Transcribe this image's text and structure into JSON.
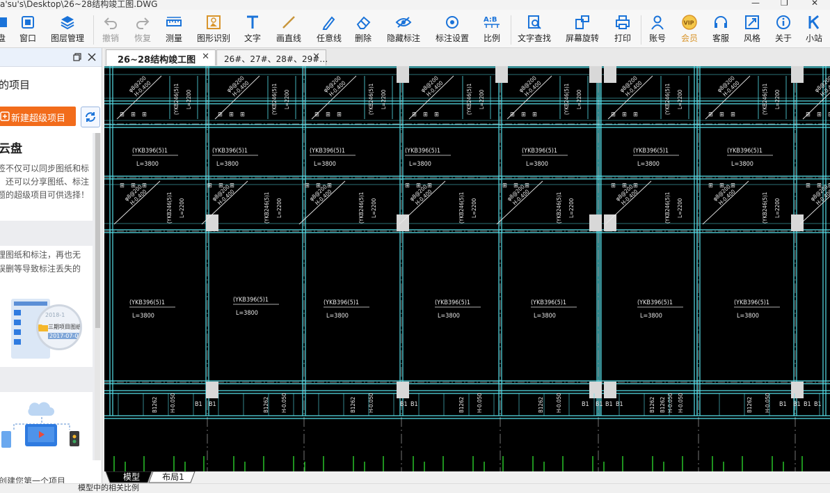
{
  "window": {
    "title": "a'su's\\Desktop\\26~28结构竣工图.DWG"
  },
  "toolbar": {
    "items": [
      {
        "label": "盘",
        "icon": "disk-icon"
      },
      {
        "label": "窗口",
        "icon": "window-icon"
      },
      {
        "label": "图层管理",
        "icon": "layers-icon"
      },
      {
        "label": "撤销",
        "icon": "undo-icon",
        "disabled": true
      },
      {
        "label": "恢复",
        "icon": "redo-icon",
        "disabled": true
      },
      {
        "label": "测量",
        "icon": "ruler-icon"
      },
      {
        "label": "图形识别",
        "icon": "shape-recognize-icon"
      },
      {
        "label": "文字",
        "icon": "text-icon"
      },
      {
        "label": "画直线",
        "icon": "line-icon"
      },
      {
        "label": "任意线",
        "icon": "pencil-icon"
      },
      {
        "label": "删除",
        "icon": "eraser-icon"
      },
      {
        "label": "隐藏标注",
        "icon": "eye-icon"
      },
      {
        "label": "标注设置",
        "icon": "annotation-settings-icon"
      },
      {
        "label": "比例",
        "icon": "scale-icon"
      },
      {
        "label": "文字查找",
        "icon": "text-search-icon"
      },
      {
        "label": "屏幕旋转",
        "icon": "rotate-screen-icon"
      },
      {
        "label": "打印",
        "icon": "printer-icon"
      },
      {
        "label": "账号",
        "icon": "user-icon"
      },
      {
        "label": "会员",
        "icon": "vip-icon"
      },
      {
        "label": "客服",
        "icon": "headset-icon"
      },
      {
        "label": "风格",
        "icon": "style-icon"
      },
      {
        "label": "关于",
        "icon": "info-icon"
      },
      {
        "label": "小站",
        "icon": "k-logo-icon"
      }
    ],
    "vip_badge": "VIP",
    "scale_icon_text": "A:B"
  },
  "panel": {
    "title": "的项目",
    "new_project_label": "新建超级项目",
    "cloud_card": {
      "title": "云盘",
      "lines": [
        "签不仅可以同步图纸和标",
        "，还可以分享图纸、标注",
        "题的超级项目可供选择！"
      ]
    },
    "manage_card": {
      "lines": [
        "理图纸和标注，再也无",
        "误删等导致标注丢失的"
      ],
      "badge_title": "三期项目图纸",
      "badge_date": "2017-07-07",
      "badge_year": "2018-1"
    },
    "footer": "创建您第一个项目"
  },
  "tabs": [
    {
      "label": "26~28结构竣工图",
      "active": true
    },
    {
      "label": "26#、27#、28#、29#…",
      "active": false
    }
  ],
  "drawing": {
    "beam_upper": "φ8@200",
    "beam_lower": "H-0.400",
    "slab_label": "(YKB396(5)1",
    "slab_length": "L=3800",
    "vslab_label": "(YKB246(5)1",
    "vslab_length": "L=2200",
    "b_code": "B1",
    "bottom_beam": "B1262",
    "bottom_h": "H-0.050"
  },
  "layout_tabs": [
    {
      "label": "模型",
      "active": true
    },
    {
      "label": "布局1",
      "active": false
    }
  ],
  "status": {
    "text": "模型中的相关比例"
  }
}
